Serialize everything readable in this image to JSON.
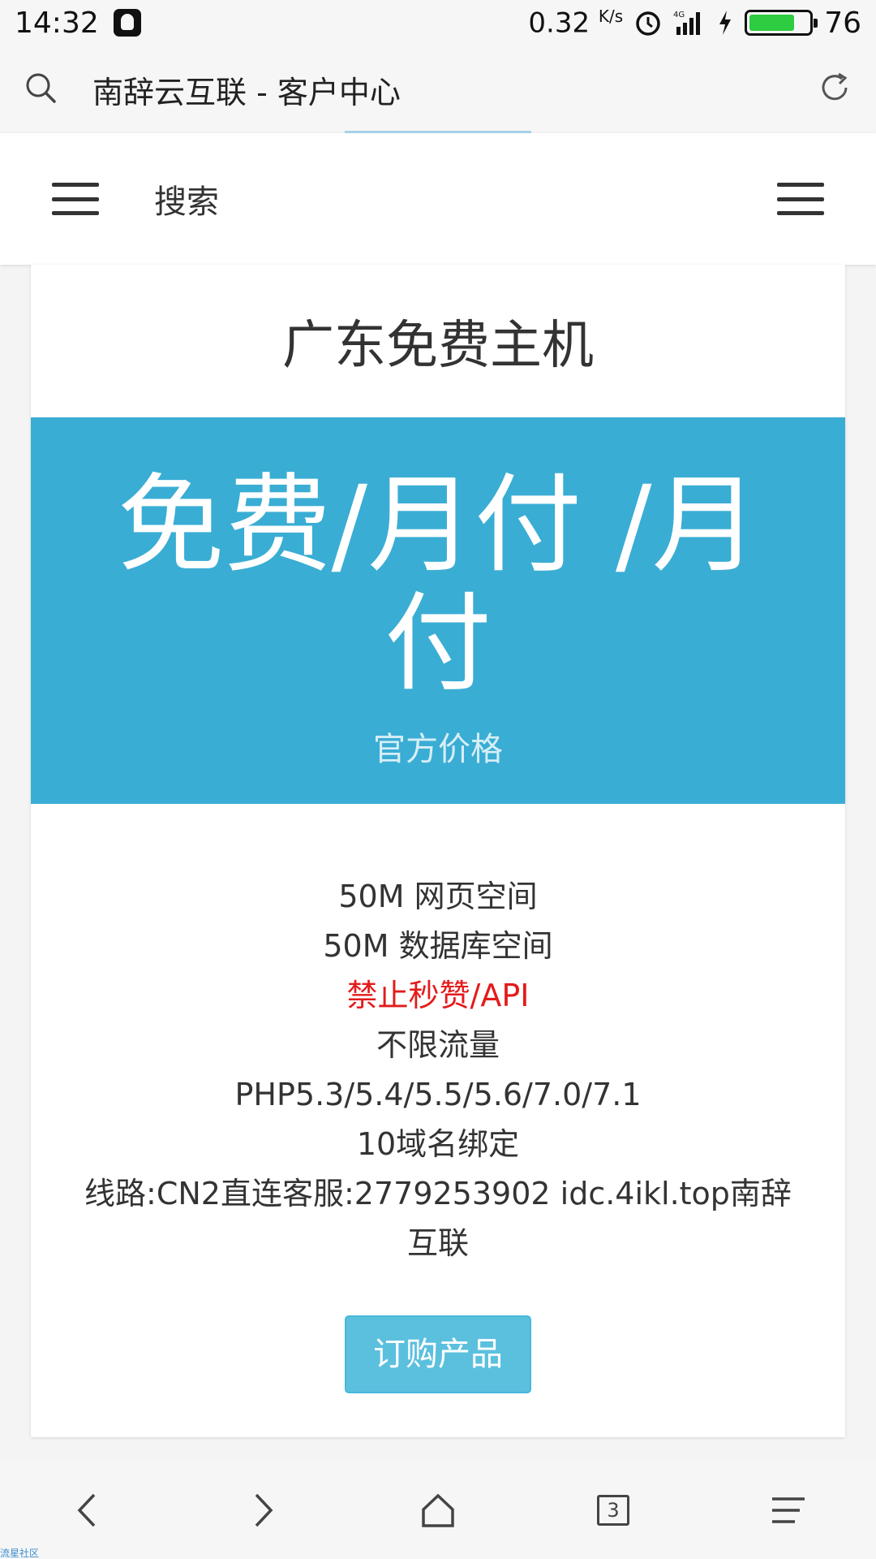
{
  "status_bar": {
    "time": "14:32",
    "speed": "0.32",
    "speed_unit": "K/s",
    "network": "4G",
    "battery_level": 76,
    "battery_text": "76"
  },
  "browser": {
    "page_title": "南辞云互联 - 客户中心"
  },
  "site_header": {
    "search_label": "搜索"
  },
  "plan": {
    "title": "广东免费主机",
    "price": "免费/月付 /月付",
    "price_note": "官方价格",
    "features": [
      "50M 网页空间",
      "50M 数据库空间",
      "禁止秒赞/API",
      "不限流量",
      "PHP5.3/5.4/5.5/5.6/7.0/7.1",
      "10域名绑定",
      "线路:CN2直连客服:2779253902 idc.4ikl.top南辞互联"
    ],
    "highlight_color": "#e31b1b",
    "order_label": "订购产品"
  },
  "bottom_nav": {
    "tab_count": "3"
  },
  "watermark": "流星社区",
  "colors": {
    "price_box": "#3aadd4",
    "order_button": "#5bc0de"
  }
}
